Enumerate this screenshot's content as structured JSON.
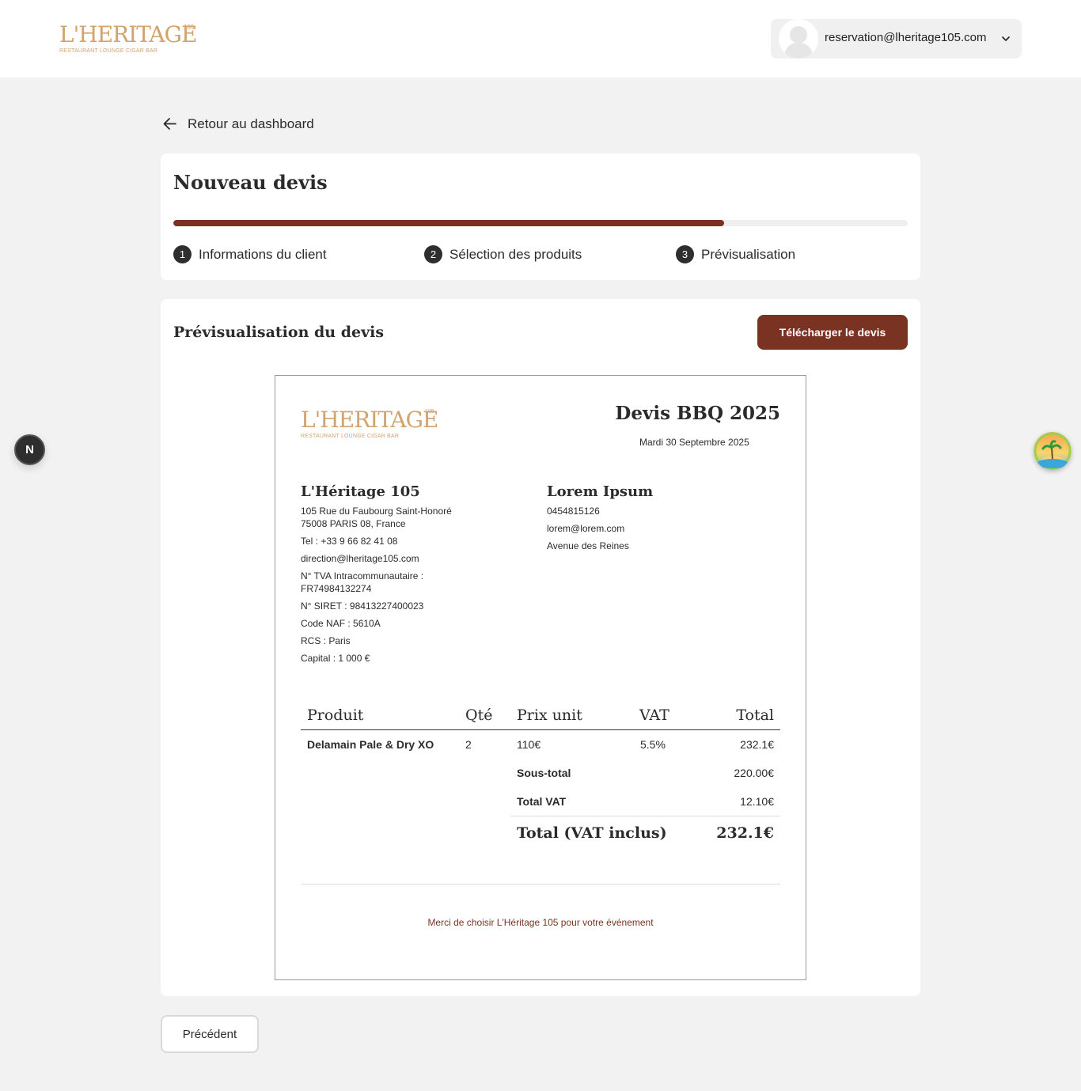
{
  "brand": {
    "logo_word": "L'HERITAGE",
    "logo_sup": "105",
    "logo_tagline": "RESTAURANT LOUNGE CIGAR BAR",
    "accent_color": "#7a3322",
    "gold_color": "#d2a36c"
  },
  "header": {
    "account_email": "reservation@lheritage105.com",
    "avatar_icon": "user-silhouette-icon",
    "dropdown_icon": "chevron-down-icon"
  },
  "nav": {
    "back_label": "Retour au dashboard",
    "back_icon": "arrow-left-icon"
  },
  "wizard": {
    "title": "Nouveau devis",
    "progress": 0.75,
    "steps": [
      {
        "num": "1",
        "label": "Informations du client"
      },
      {
        "num": "2",
        "label": "Sélection des produits"
      },
      {
        "num": "3",
        "label": "Prévisualisation"
      }
    ]
  },
  "preview": {
    "title": "Prévisualisation du devis",
    "download_label": "Télécharger le devis"
  },
  "quote": {
    "title": "Devis BBQ 2025",
    "date": "Mardi 30 Septembre 2025",
    "seller": {
      "name": "L'Héritage 105",
      "address_line1": "105 Rue du Faubourg Saint-Honoré",
      "address_line2": "75008 PARIS 08, France",
      "tel": "Tel : +33 9 66 82 41 08",
      "email": "direction@lheritage105.com",
      "vat_label": "N° TVA Intracommunautaire :",
      "vat_number": "FR74984132274",
      "siret": "N° SIRET : 98413227400023",
      "naf": "Code NAF : 5610A",
      "rcs": "RCS : Paris",
      "capital": "Capital : 1 000 €"
    },
    "client": {
      "name": "Lorem Ipsum",
      "phone": "0454815126",
      "email": "lorem@lorem.com",
      "address": "Avenue des Reines"
    },
    "columns": {
      "product": "Produit",
      "qty": "Qté",
      "unit_price": "Prix unit",
      "vat": "VAT",
      "total": "Total"
    },
    "items": [
      {
        "product": "Delamain Pale & Dry XO",
        "qty": "2",
        "unit_price": "110€",
        "vat": "5.5%",
        "total": "232.1€"
      }
    ],
    "subtotal_label": "Sous-total",
    "subtotal_value": "220.00€",
    "vat_total_label": "Total VAT",
    "vat_total_value": "12.10€",
    "grand_total_label": "Total (VAT inclus)",
    "grand_total_value": "232.1€",
    "thanks": "Merci de choisir L'Héritage 105 pour votre événement"
  },
  "footer": {
    "prev_label": "Précédent"
  },
  "overlays": {
    "next_badge": "N",
    "widget_icon": "island-widget-icon"
  }
}
